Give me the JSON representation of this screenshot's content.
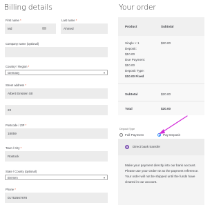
{
  "billing": {
    "title": "Billing details",
    "first_name_label": "First name",
    "first_name_value": "Md",
    "last_name_label": "Last name",
    "last_name_value": "Ahmed",
    "company_label": "Company name (optional)",
    "company_value": "",
    "country_label": "Country / Region",
    "country_value": "Germany",
    "street_label": "Street address",
    "street_value": "Albert Einstein Str",
    "street2_value": "23",
    "postcode_label": "Postcode / ZIP",
    "postcode_value": "18059",
    "town_label": "Town / City",
    "town_value": "Rostock",
    "state_label": "State / County (optional)",
    "state_value": "Bremen",
    "phone_label": "Phone",
    "phone_value": "01752567878",
    "required_mark": "*"
  },
  "order": {
    "title": "Your order",
    "col_product": "Product",
    "col_subtotal": "Subtotal",
    "item_line1": "Single  × 1",
    "item_line2": "Deposit:",
    "item_line3": "$10.00",
    "item_line4": "Due Payment:",
    "item_line5": "$10.00",
    "item_line6": "Deposit Type:",
    "item_line7": "$10.00 Fixed",
    "item_subtotal": "$20.00",
    "subtotal_label": "Subtotal",
    "subtotal_value": "$20.00",
    "total_label": "Total",
    "total_value": "$20.00"
  },
  "deposit": {
    "type_label": "Deposit Type",
    "full_label": "Full Payment",
    "pay_deposit_label": "Pay Deposit",
    "selected": "Pay Deposit"
  },
  "payment": {
    "method_label": "Direct bank transfer",
    "description": "Make your payment directly into our bank account. Please use your Order ID as the payment reference. Your order will not be shipped until the funds have cleared in our account."
  },
  "colors": {
    "accent_arrow": "#d22bd8",
    "radio_selected": "#2c8ef8",
    "payment_radio": "#7f54b3",
    "required": "#e2401c"
  }
}
